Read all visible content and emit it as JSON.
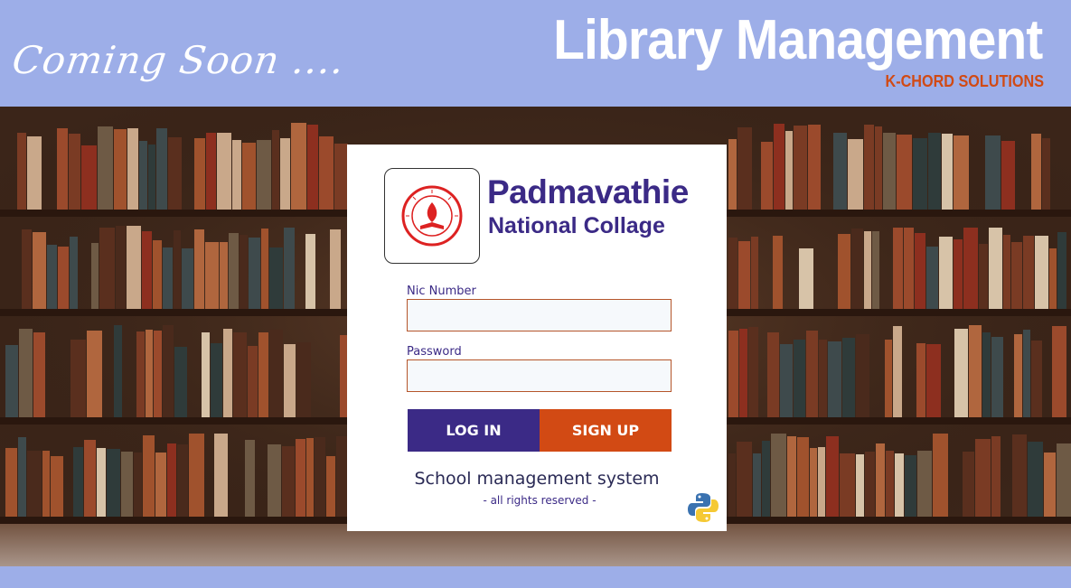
{
  "header": {
    "coming_soon": "Coming Soon ....",
    "app_title": "Library Management",
    "company": "K-CHORD SOLUTIONS"
  },
  "card": {
    "college_name_line1": "Padmavathie",
    "college_name_line2": "National Collage",
    "nic_label": "Nic Number",
    "nic_value": "",
    "password_label": "Password",
    "password_value": "",
    "login_label": "LOG IN",
    "signup_label": "SIGN UP",
    "system_name": "School management system",
    "rights": "- all rights reserved -",
    "logo_icon": "college-emblem",
    "python_icon": "python-logo"
  },
  "colors": {
    "banner": "#9daee8",
    "primary": "#3b2a86",
    "accent": "#d24a14"
  }
}
